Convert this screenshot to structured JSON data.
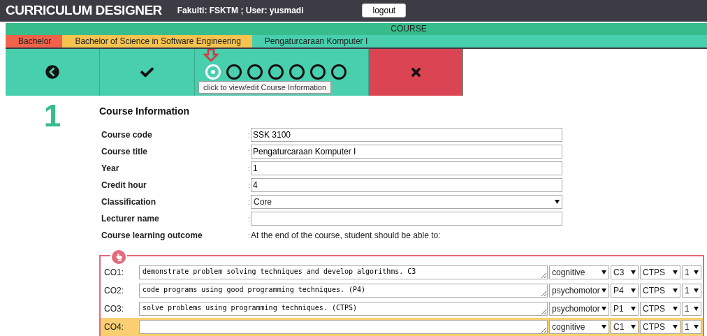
{
  "header": {
    "title": "CURRICULUM DESIGNER",
    "user_info": "Fakulti: FSKTM ; User: yusmadi",
    "logout_button": "logout"
  },
  "section_bar": {
    "label": "COURSE"
  },
  "breadcrumb": [
    {
      "label": "Bachelor",
      "color": "#f0634a"
    },
    {
      "label": "Bachelor of Science in Software Engineering",
      "color": "#f7c34f"
    },
    {
      "label": "Pengaturcaraan Komputer I",
      "color": "#48cfad"
    }
  ],
  "toolbar": {
    "steps": [
      {
        "selected": true
      },
      {
        "selected": false
      },
      {
        "selected": false
      },
      {
        "selected": false
      },
      {
        "selected": false
      },
      {
        "selected": false
      },
      {
        "selected": false
      }
    ],
    "tooltip": "click to view/edit Course Information"
  },
  "step_number": "1",
  "form": {
    "heading": "Course Information",
    "fields": [
      {
        "label": "Course code",
        "separator": ":",
        "kind": "input",
        "value": "SSK 3100"
      },
      {
        "label": "Course title",
        "separator": ":",
        "kind": "input",
        "value": "Pengaturcaraan Komputer I"
      },
      {
        "label": "Year",
        "separator": ":",
        "kind": "input",
        "value": "1"
      },
      {
        "label": "Credit hour",
        "separator": ":",
        "kind": "input",
        "value": "4"
      },
      {
        "label": "Classification",
        "separator": ":",
        "kind": "select",
        "value": "Core"
      },
      {
        "label": "Lecturer name",
        "separator": ":",
        "kind": "input"
      },
      {
        "label": "Course learning outcome",
        "separator": ":",
        "kind": "text",
        "value": "At the end of the course, student should be able to:"
      }
    ]
  },
  "outcomes": [
    {
      "label": "CO1:",
      "text": "demonstrate problem solving techniques and develop algorithms. C3",
      "domain": "cognitive",
      "level": "C3",
      "skill": "CTPS",
      "number": "1",
      "selected": false
    },
    {
      "label": "CO2:",
      "text": "code programs using good programming techniques. (P4)",
      "domain": "psychomotor",
      "level": "P4",
      "skill": "CTPS",
      "number": "1",
      "selected": false
    },
    {
      "label": "CO3:",
      "text": "solve problems using programming techniques. (CTPS)",
      "domain": "psychomotor",
      "level": "P1",
      "skill": "CTPS",
      "number": "1",
      "selected": false
    },
    {
      "label": "CO4:",
      "domain": "cognitive",
      "level": "C1",
      "skill": "CTPS",
      "number": "1",
      "selected": true
    }
  ]
}
